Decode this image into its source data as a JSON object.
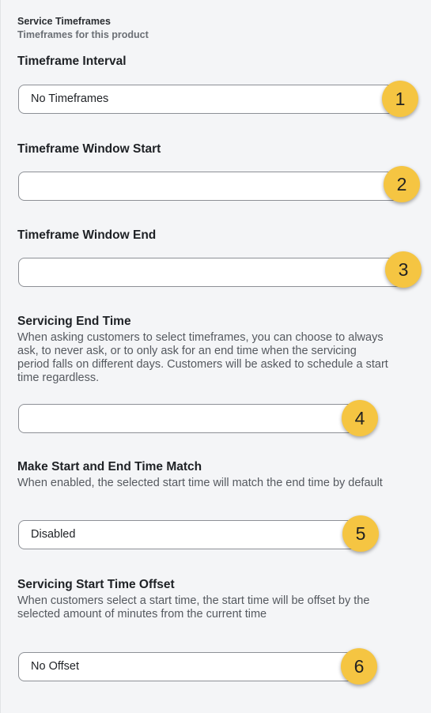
{
  "section": {
    "title": "Service Timeframes",
    "subtitle": "Timeframes for this product"
  },
  "fields": [
    {
      "label": "Timeframe Interval",
      "value": "No Timeframes",
      "badge": "1"
    },
    {
      "label": "Timeframe Window Start",
      "value": "",
      "badge": "2"
    },
    {
      "label": "Timeframe Window End",
      "value": "",
      "badge": "3"
    },
    {
      "label": "Servicing End Time",
      "description": "When asking customers to select timeframes, you can choose to always ask, to never ask, or to only ask for an end time when the servicing period falls on different days. Customers will be asked to schedule a start time regardless.",
      "value": "",
      "badge": "4"
    },
    {
      "label": "Make Start and End Time Match",
      "description": "When enabled, the selected start time will match the end time by default",
      "value": "Disabled",
      "badge": "5"
    },
    {
      "label": "Servicing Start Time Offset",
      "description": "When customers select a start time, the start time will be offset by the selected amount of minutes from the current time",
      "value": "No Offset",
      "badge": "6"
    }
  ],
  "colors": {
    "badge": "#f5c542",
    "field_border": "#8d9096",
    "background": "#f4f5f7"
  }
}
